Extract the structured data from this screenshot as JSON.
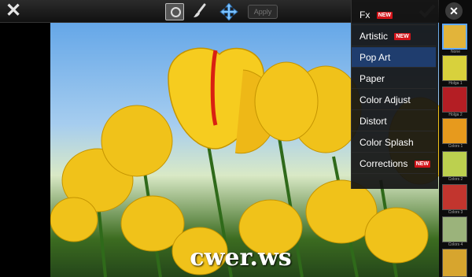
{
  "toolbar": {
    "apply_label": "Apply",
    "icons": [
      "close-icon",
      "snapshot-icon",
      "brush-icon",
      "move-icon",
      "checkmark-icon"
    ]
  },
  "effects_menu": {
    "items": [
      {
        "label": "Fx",
        "badge": "NEW"
      },
      {
        "label": "Artistic",
        "badge": "NEW"
      },
      {
        "label": "Pop Art",
        "badge": ""
      },
      {
        "label": "Paper",
        "badge": ""
      },
      {
        "label": "Color Adjust",
        "badge": ""
      },
      {
        "label": "Distort",
        "badge": ""
      },
      {
        "label": "Color Splash",
        "badge": ""
      },
      {
        "label": "Corrections",
        "badge": "NEW"
      }
    ],
    "selected": "Pop Art"
  },
  "presets": {
    "items": [
      {
        "label": "None",
        "color": "#e2b43a"
      },
      {
        "label": "Holga 1",
        "color": "#d8d13c"
      },
      {
        "label": "Holga 2",
        "color": "#b41e24"
      },
      {
        "label": "Colors 1",
        "color": "#e79a1d"
      },
      {
        "label": "Colors 2",
        "color": "#bcd04f"
      },
      {
        "label": "Colors 3",
        "color": "#c2352e"
      },
      {
        "label": "Colors 4",
        "color": "#9bb37b"
      },
      {
        "label": "",
        "color": "#d7a52e"
      }
    ],
    "selected": "None"
  },
  "watermark": "cwer.ws",
  "colors": {
    "accent_selected": "#1f3d6e",
    "badge": "#d2141a",
    "thumb_selected_border": "#5fa8ff"
  }
}
